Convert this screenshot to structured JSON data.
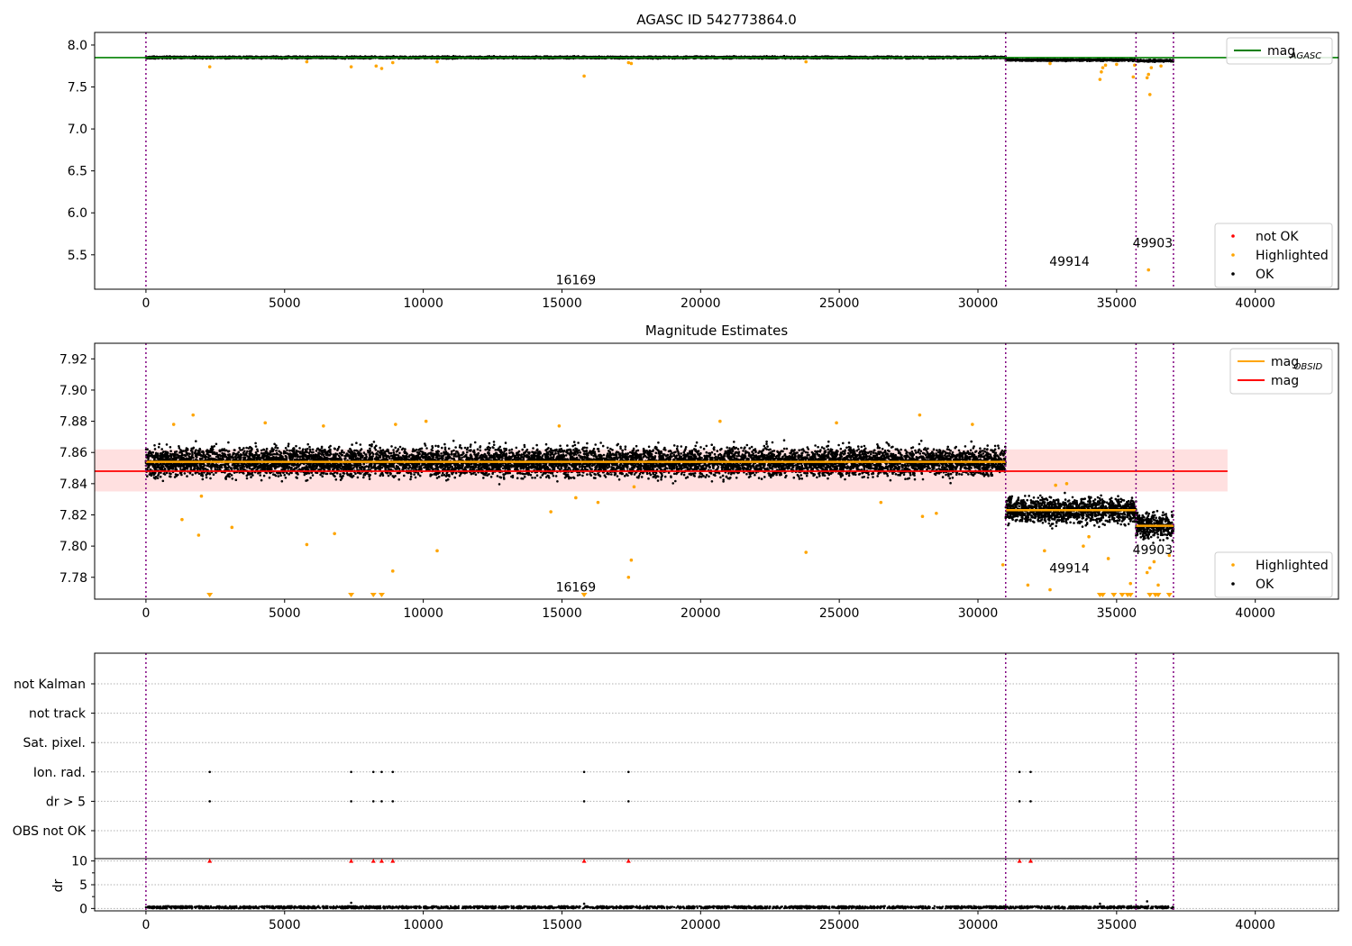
{
  "chart_data": [
    {
      "type": "scatter",
      "title": "AGASC ID 542773864.0",
      "xlim": [
        -1850,
        43000
      ],
      "ylim": [
        5.09,
        8.15
      ],
      "xticks": [
        0,
        5000,
        10000,
        15000,
        20000,
        25000,
        30000,
        35000,
        40000
      ],
      "xtick_labels": [
        "0",
        "5000",
        "10000",
        "15000",
        "20000",
        "25000",
        "30000",
        "35000",
        "40000"
      ],
      "yticks": [
        5.5,
        6.0,
        6.5,
        7.0,
        7.5,
        8.0
      ],
      "ytick_labels": [
        "5.5",
        "6.0",
        "6.5",
        "7.0",
        "7.5",
        "8.0"
      ],
      "obsid_boundaries": [
        0,
        31000,
        35700,
        37050
      ],
      "obsid_labels": [
        {
          "text": "16169",
          "x": 15500,
          "y": 5.15
        },
        {
          "text": "49914",
          "x": 33300,
          "y": 5.37
        },
        {
          "text": "49903",
          "x": 36300,
          "y": 5.59
        }
      ],
      "reference_lines": [
        {
          "name": "mag_AGASC",
          "y": 7.85,
          "x_range": [
            -1850,
            43000
          ],
          "color": "#008000"
        }
      ],
      "ok_bands": [
        {
          "x": [
            0,
            31000
          ],
          "y_center": 7.852,
          "spread": 0.012
        },
        {
          "x": [
            31000,
            35700
          ],
          "y_center": 7.822,
          "spread": 0.012
        },
        {
          "x": [
            35700,
            37050
          ],
          "y_center": 7.813,
          "spread": 0.012
        }
      ],
      "highlighted_points": [
        {
          "x": 2300,
          "y": 7.74
        },
        {
          "x": 7400,
          "y": 7.74
        },
        {
          "x": 8300,
          "y": 7.75
        },
        {
          "x": 8500,
          "y": 7.72
        },
        {
          "x": 8900,
          "y": 7.79
        },
        {
          "x": 10500,
          "y": 7.8
        },
        {
          "x": 5800,
          "y": 7.8
        },
        {
          "x": 15800,
          "y": 7.63
        },
        {
          "x": 17400,
          "y": 7.79
        },
        {
          "x": 17500,
          "y": 7.78
        },
        {
          "x": 23800,
          "y": 7.8
        },
        {
          "x": 32600,
          "y": 7.78
        },
        {
          "x": 34400,
          "y": 7.59
        },
        {
          "x": 34450,
          "y": 7.68
        },
        {
          "x": 34500,
          "y": 7.73
        },
        {
          "x": 34600,
          "y": 7.76
        },
        {
          "x": 35000,
          "y": 7.77
        },
        {
          "x": 35600,
          "y": 7.62
        },
        {
          "x": 35650,
          "y": 7.76
        },
        {
          "x": 36200,
          "y": 7.41
        },
        {
          "x": 36100,
          "y": 7.61
        },
        {
          "x": 36150,
          "y": 7.65
        },
        {
          "x": 36250,
          "y": 7.73
        },
        {
          "x": 36600,
          "y": 7.75
        },
        {
          "x": 36150,
          "y": 5.32
        }
      ],
      "legends": [
        {
          "position": "upper right",
          "entries": [
            {
              "label": "mag",
              "sub": "AGASC",
              "kind": "line",
              "color": "#008000"
            }
          ]
        },
        {
          "position": "lower right",
          "entries": [
            {
              "label": "not OK",
              "kind": "marker",
              "color": "#ff0000"
            },
            {
              "label": "Highlighted",
              "kind": "marker",
              "color": "#ffa500"
            },
            {
              "label": "OK",
              "kind": "marker",
              "color": "#000000"
            }
          ]
        }
      ]
    },
    {
      "type": "scatter",
      "title": "Magnitude Estimates",
      "xlim": [
        -1850,
        43000
      ],
      "ylim": [
        7.766,
        7.93
      ],
      "xticks": [
        0,
        5000,
        10000,
        15000,
        20000,
        25000,
        30000,
        35000,
        40000
      ],
      "xtick_labels": [
        "0",
        "5000",
        "10000",
        "15000",
        "20000",
        "25000",
        "30000",
        "35000",
        "40000"
      ],
      "yticks": [
        7.78,
        7.8,
        7.82,
        7.84,
        7.86,
        7.88,
        7.9,
        7.92
      ],
      "ytick_labels": [
        "7.78",
        "7.80",
        "7.82",
        "7.84",
        "7.86",
        "7.88",
        "7.90",
        "7.92"
      ],
      "obsid_boundaries": [
        0,
        31000,
        35700,
        37050
      ],
      "obsid_labels": [
        {
          "text": "16169",
          "x": 15500,
          "y": 7.771
        },
        {
          "text": "49914",
          "x": 33300,
          "y": 7.783
        },
        {
          "text": "49903",
          "x": 36300,
          "y": 7.795
        }
      ],
      "mag_band": {
        "y": 7.848,
        "low": 7.835,
        "high": 7.862,
        "x_range": [
          -1850,
          39000
        ],
        "color": "#ff0000"
      },
      "mag_obsid": [
        {
          "x": [
            0,
            31000
          ],
          "y": 7.854
        },
        {
          "x": [
            31000,
            35700
          ],
          "y": 7.823
        },
        {
          "x": [
            35700,
            37050
          ],
          "y": 7.813
        }
      ],
      "ok_bands": [
        {
          "x": [
            0,
            31000
          ],
          "y_center": 7.854,
          "spread": 0.01
        },
        {
          "x": [
            31000,
            35700
          ],
          "y_center": 7.823,
          "spread": 0.009
        },
        {
          "x": [
            35700,
            37050
          ],
          "y_center": 7.813,
          "spread": 0.009
        }
      ],
      "highlighted_points": [
        {
          "x": 1300,
          "y": 7.817
        },
        {
          "x": 1900,
          "y": 7.807
        },
        {
          "x": 2000,
          "y": 7.832
        },
        {
          "x": 3100,
          "y": 7.812
        },
        {
          "x": 5800,
          "y": 7.801
        },
        {
          "x": 6800,
          "y": 7.808
        },
        {
          "x": 8900,
          "y": 7.784
        },
        {
          "x": 10500,
          "y": 7.797
        },
        {
          "x": 14600,
          "y": 7.822
        },
        {
          "x": 15500,
          "y": 7.831
        },
        {
          "x": 16300,
          "y": 7.828
        },
        {
          "x": 17400,
          "y": 7.78
        },
        {
          "x": 17500,
          "y": 7.791
        },
        {
          "x": 17600,
          "y": 7.838
        },
        {
          "x": 23800,
          "y": 7.796
        },
        {
          "x": 26500,
          "y": 7.828
        },
        {
          "x": 28000,
          "y": 7.819
        },
        {
          "x": 28500,
          "y": 7.821
        },
        {
          "x": 30900,
          "y": 7.788
        },
        {
          "x": 31800,
          "y": 7.775
        },
        {
          "x": 32400,
          "y": 7.797
        },
        {
          "x": 32600,
          "y": 7.772
        },
        {
          "x": 33800,
          "y": 7.8
        },
        {
          "x": 34000,
          "y": 7.806
        },
        {
          "x": 34700,
          "y": 7.792
        },
        {
          "x": 35500,
          "y": 7.776
        },
        {
          "x": 36100,
          "y": 7.783
        },
        {
          "x": 36200,
          "y": 7.786
        },
        {
          "x": 36350,
          "y": 7.79
        },
        {
          "x": 36500,
          "y": 7.775
        },
        {
          "x": 36900,
          "y": 7.794
        },
        {
          "x": 1000,
          "y": 7.878
        },
        {
          "x": 1700,
          "y": 7.884
        },
        {
          "x": 4300,
          "y": 7.879
        },
        {
          "x": 6400,
          "y": 7.877
        },
        {
          "x": 9000,
          "y": 7.878
        },
        {
          "x": 10100,
          "y": 7.88
        },
        {
          "x": 14900,
          "y": 7.877
        },
        {
          "x": 20700,
          "y": 7.88
        },
        {
          "x": 24900,
          "y": 7.879
        },
        {
          "x": 27900,
          "y": 7.884
        },
        {
          "x": 29800,
          "y": 7.878
        },
        {
          "x": 33200,
          "y": 7.84
        },
        {
          "x": 32800,
          "y": 7.839
        }
      ],
      "below_range_markers": [
        2300,
        7400,
        8200,
        8500,
        15800,
        34400,
        34500,
        34900,
        35200,
        35400,
        35500,
        36200,
        36400,
        36500,
        36900
      ],
      "legends": [
        {
          "position": "upper right",
          "entries": [
            {
              "label": "mag",
              "sub": "OBSID",
              "kind": "line",
              "color": "#ffa500"
            },
            {
              "label": "mag",
              "kind": "line",
              "color": "#ff0000"
            }
          ]
        },
        {
          "position": "lower right",
          "entries": [
            {
              "label": "Highlighted",
              "kind": "marker",
              "color": "#ffa500"
            },
            {
              "label": "OK",
              "kind": "marker",
              "color": "#000000"
            }
          ]
        }
      ]
    },
    {
      "type": "scatter",
      "title": "",
      "xlim": [
        -1850,
        43000
      ],
      "flag_rows": [
        "not Kalman",
        "not track",
        "Sat. pixel.",
        "Ion. rad.",
        "dr > 5",
        "OBS not OK"
      ],
      "flag_points": [
        {
          "row": "Ion. rad.",
          "x": [
            2300,
            7400,
            8200,
            8500,
            8900,
            15800,
            17400,
            31500,
            31900
          ]
        },
        {
          "row": "dr > 5",
          "x": [
            2300,
            7400,
            8200,
            8500,
            8900,
            15800,
            17400,
            31500,
            31900
          ]
        }
      ],
      "obsid_boundaries": [
        0,
        31000,
        35700,
        37050
      ]
    },
    {
      "type": "scatter",
      "title": "",
      "xlim": [
        -1850,
        43000
      ],
      "ylim": [
        -0.5,
        10.5
      ],
      "ylabel": "dr",
      "xticks": [
        0,
        5000,
        10000,
        15000,
        20000,
        25000,
        30000,
        35000,
        40000
      ],
      "xtick_labels": [
        "0",
        "5000",
        "10000",
        "15000",
        "20000",
        "25000",
        "30000",
        "35000",
        "40000"
      ],
      "yticks": [
        0,
        5,
        10
      ],
      "ytick_labels": [
        "0",
        "5",
        "10"
      ],
      "dr_band": {
        "x": [
          0,
          37050
        ],
        "y_low": 0.0,
        "y_high": 0.5
      },
      "dr_spikes": [
        {
          "x": 7400,
          "y": 1.2
        },
        {
          "x": 15800,
          "y": 1.0
        },
        {
          "x": 34400,
          "y": 1.0
        },
        {
          "x": 36100,
          "y": 1.5
        }
      ],
      "clipped_markers_x": [
        2300,
        7400,
        8200,
        8500,
        8900,
        15800,
        17400,
        31500,
        31900
      ],
      "obsid_boundaries": [
        0,
        31000,
        35700,
        37050
      ]
    }
  ]
}
